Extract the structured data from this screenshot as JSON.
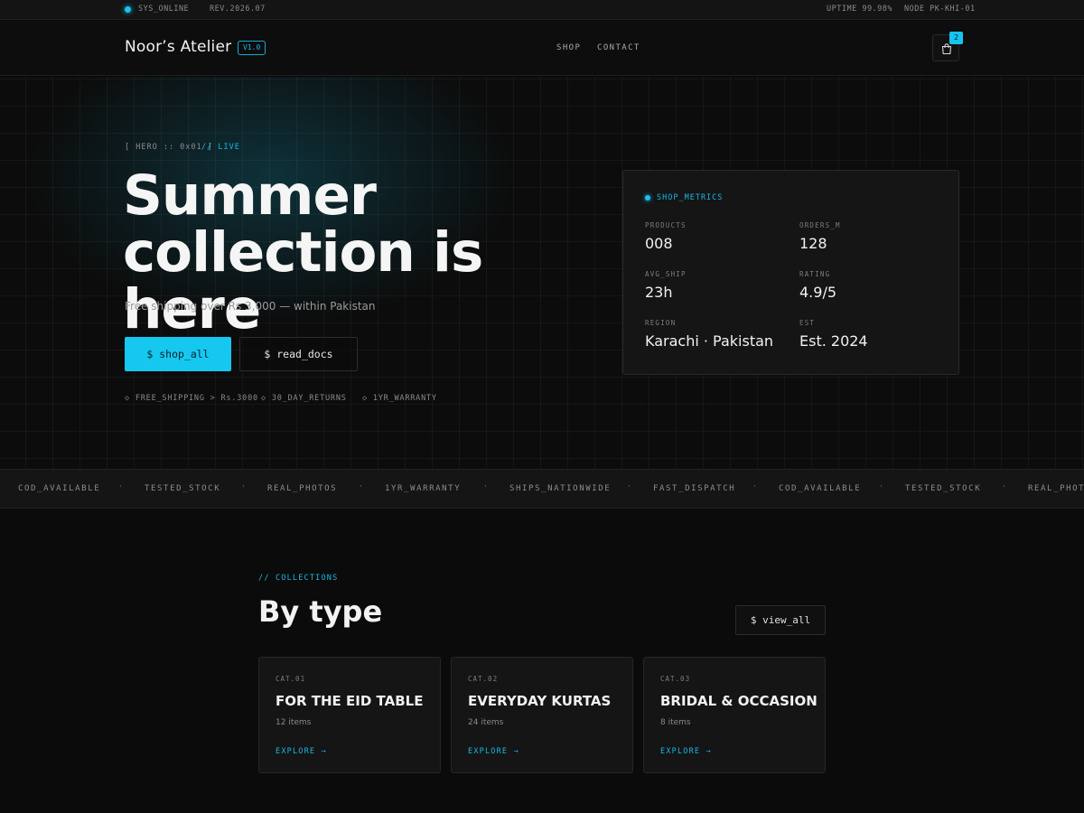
{
  "statusbar": {
    "status": "SYS_ONLINE",
    "revision": "REV.2026.07",
    "uptime": "UPTIME 99.98%",
    "node": "NODE PK-KHI-01"
  },
  "nav": {
    "brand": "Noor’s Atelier",
    "version": "V1.0",
    "links": [
      "SHOP",
      "CONTACT"
    ],
    "cart_count": "2"
  },
  "hero": {
    "tag": "[ HERO :: 0x01 ]",
    "live": "// LIVE",
    "title_line1": "Summer",
    "title_line2": "collection is here",
    "subtitle": "Free shipping over Rs 3,000 — within Pakistan",
    "primary_button": "$ shop_all",
    "secondary_button": "$ read_docs",
    "features": [
      "◇ FREE_SHIPPING > Rs.3000",
      "◇ 30_DAY_RETURNS",
      "◇ 1YR_WARRANTY"
    ]
  },
  "metrics": {
    "title": "SHOP_METRICS",
    "items": [
      {
        "label": "PRODUCTS",
        "value": "008"
      },
      {
        "label": "ORDERS_M",
        "value": "128"
      },
      {
        "label": "AVG_SHIP",
        "value": "23h"
      },
      {
        "label": "RATING",
        "value": "4.9/5"
      },
      {
        "label": "REGION",
        "value": "Karachi · Pakistan"
      },
      {
        "label": "EST",
        "value": "Est. 2024"
      }
    ]
  },
  "marquee": {
    "items": [
      "COD_AVAILABLE",
      "TESTED_STOCK",
      "REAL_PHOTOS",
      "1YR_WARRANTY",
      "SHIPS_NATIONWIDE",
      "FAST_DISPATCH",
      "COD_AVAILABLE",
      "TESTED_STOCK",
      "REAL_PHOTOS"
    ],
    "separator": "·"
  },
  "collections": {
    "tag": "// COLLECTIONS",
    "title": "By type",
    "view_all": "$ view_all",
    "cards": [
      {
        "code": "CAT.01",
        "name": "FOR THE EID TABLE",
        "count": "12 items",
        "cta": "EXPLORE →"
      },
      {
        "code": "CAT.02",
        "name": "EVERYDAY KURTAS",
        "count": "24 items",
        "cta": "EXPLORE →"
      },
      {
        "code": "CAT.03",
        "name": "BRIDAL & OCCASION",
        "count": "8 items",
        "cta": "EXPLORE →"
      }
    ]
  },
  "colors": {
    "accent": "#16c8f0",
    "background": "#0b0b0b",
    "panel": "#151515"
  }
}
